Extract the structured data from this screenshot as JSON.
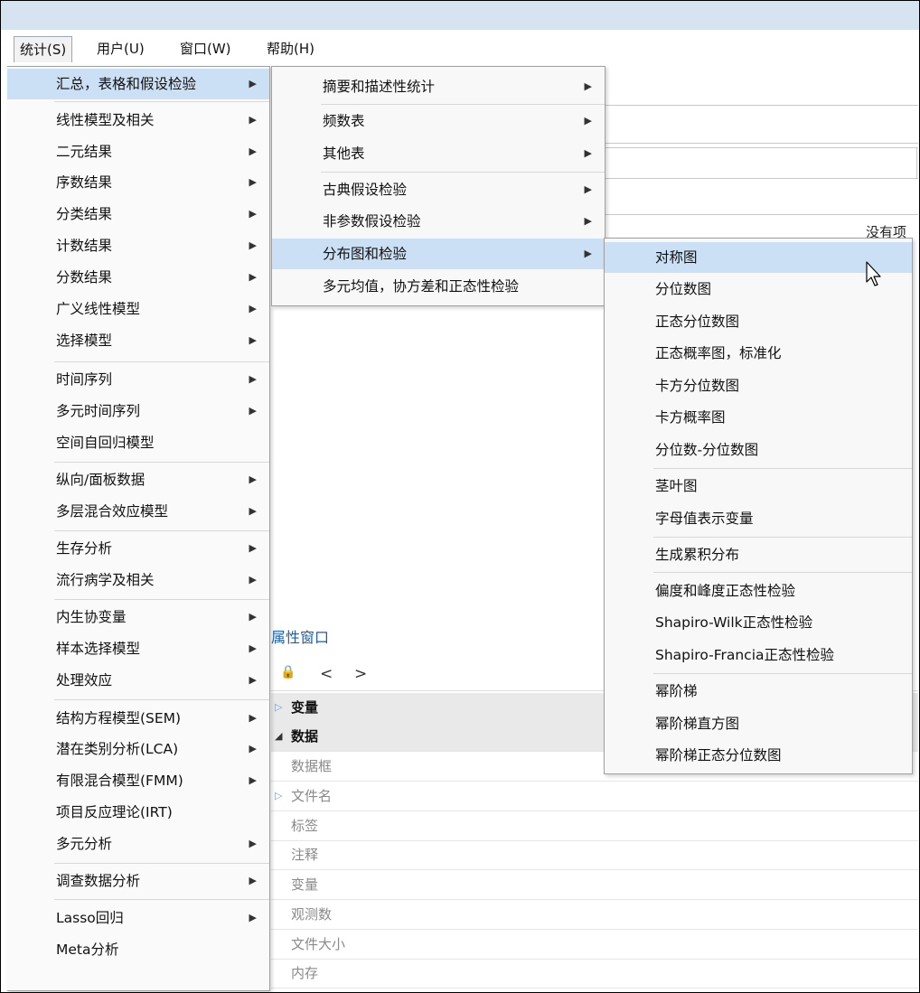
{
  "menubar": [
    {
      "label": "统计(S)",
      "active": true
    },
    {
      "label": "用户(U)"
    },
    {
      "label": "窗口(W)"
    },
    {
      "label": "帮助(H)"
    }
  ],
  "background": {
    "no_items_text": "没有项",
    "properties_title": "属性窗口",
    "toolbar": {
      "lock": "🔒",
      "prev": "<",
      "next": ">"
    },
    "rows": [
      {
        "label": "变量",
        "type": "head",
        "arrow": "▷"
      },
      {
        "label": "数据",
        "type": "head",
        "arrow": "◢"
      },
      {
        "label": "数据框",
        "type": "sub"
      },
      {
        "label": "文件名",
        "type": "sub",
        "arrow": "▷"
      },
      {
        "label": "标签",
        "type": "sub"
      },
      {
        "label": "注释",
        "type": "sub"
      },
      {
        "label": "变量",
        "type": "sub"
      },
      {
        "label": "观测数",
        "type": "sub"
      },
      {
        "label": "文件大小",
        "type": "sub"
      },
      {
        "label": "内存",
        "type": "sub"
      }
    ]
  },
  "menu_level1": [
    {
      "label": "汇总，表格和假设检验",
      "sub": true,
      "hl": true
    },
    {
      "label": "线性模型及相关",
      "sub": true
    },
    {
      "label": "二元结果",
      "sub": true
    },
    {
      "label": "序数结果",
      "sub": true
    },
    {
      "label": "分类结果",
      "sub": true
    },
    {
      "label": "计数结果",
      "sub": true
    },
    {
      "label": "分数结果",
      "sub": true
    },
    {
      "label": "广义线性模型",
      "sub": true
    },
    {
      "label": "选择模型",
      "sub": true
    },
    {
      "label": "时间序列",
      "sub": true
    },
    {
      "label": "多元时间序列",
      "sub": true
    },
    {
      "label": "空间自回归模型",
      "sub": false
    },
    {
      "label": "纵向/面板数据",
      "sub": true
    },
    {
      "label": "多层混合效应模型",
      "sub": true
    },
    {
      "label": "生存分析",
      "sub": true
    },
    {
      "label": "流行病学及相关",
      "sub": true
    },
    {
      "label": "内生协变量",
      "sub": true
    },
    {
      "label": "样本选择模型",
      "sub": true
    },
    {
      "label": "处理效应",
      "sub": true
    },
    {
      "label": "结构方程模型(SEM)",
      "sub": true
    },
    {
      "label": "潜在类别分析(LCA)",
      "sub": true
    },
    {
      "label": "有限混合模型(FMM)",
      "sub": true
    },
    {
      "label": "项目反应理论(IRT)",
      "sub": false
    },
    {
      "label": "多元分析",
      "sub": true
    },
    {
      "label": "调查数据分析",
      "sub": true
    },
    {
      "label": "Lasso回归",
      "sub": true
    },
    {
      "label": "Meta分析",
      "sub": false
    }
  ],
  "menu_level2": [
    {
      "label": "摘要和描述性统计",
      "sub": true
    },
    {
      "label": "频数表",
      "sub": true
    },
    {
      "label": "其他表",
      "sub": true
    },
    {
      "label": "古典假设检验",
      "sub": true
    },
    {
      "label": "非参数假设检验",
      "sub": true
    },
    {
      "label": "分布图和检验",
      "sub": true,
      "hl": true
    },
    {
      "label": "多元均值，协方差和正态性检验",
      "sub": false
    }
  ],
  "menu_level3": [
    {
      "label": "对称图",
      "hl": true
    },
    {
      "label": "分位数图"
    },
    {
      "label": "正态分位数图"
    },
    {
      "label": "正态概率图，标准化"
    },
    {
      "label": "卡方分位数图"
    },
    {
      "label": "卡方概率图"
    },
    {
      "label": "分位数-分位数图"
    },
    {
      "label": "茎叶图"
    },
    {
      "label": "字母值表示变量"
    },
    {
      "label": "生成累积分布"
    },
    {
      "label": "偏度和峰度正态性检验"
    },
    {
      "label": "Shapiro-Wilk正态性检验"
    },
    {
      "label": "Shapiro-Francia正态性检验"
    },
    {
      "label": "幂阶梯"
    },
    {
      "label": "幂阶梯直方图"
    },
    {
      "label": "幂阶梯正态分位数图"
    }
  ]
}
